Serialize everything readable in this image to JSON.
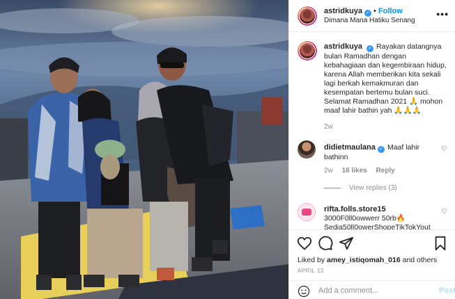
{
  "post": {
    "username": "astridkuya",
    "follow_label": "Follow",
    "separator": "•",
    "location": "Dimana Mana Hatiku Senang",
    "more_label": "•••"
  },
  "caption": {
    "username": "astridkuya",
    "text": "Rayakan datangnya bulan Ramadhan dengan kebahagiaan dan kegembiraan hidup, karena Allah memberikan kita sekali lagi berkah kemakmuran dan kesempatan bertemu bulan suci. Selamat Ramadhan 2021 🙏 mohon maaf lahir bathin yah 🙏🙏🙏",
    "time": "2w"
  },
  "comments": [
    {
      "username": "didietmaulana",
      "text": "Maaf lahir bathinn",
      "time": "2w",
      "likes": "16 likes",
      "reply_label": "Reply",
      "view_replies": "View replies (3)"
    },
    {
      "username": "rifta.folls.store15",
      "text": "3000F0ll0owwerr 50rb🔥 Sedia50ll0owerShopeTikTokYout"
    }
  ],
  "actions": {
    "liked_by_prefix": "Liked by",
    "liked_by_user": "amey_istiqomah_016",
    "liked_by_suffix": "and others",
    "date": "APRIL 12",
    "add_comment_placeholder": "Add a comment...",
    "post_label": "Post"
  },
  "colors": {
    "link_blue": "#0095f6",
    "muted": "#8e8e8e",
    "text": "#262626",
    "post_disabled": "#b2dffc"
  }
}
